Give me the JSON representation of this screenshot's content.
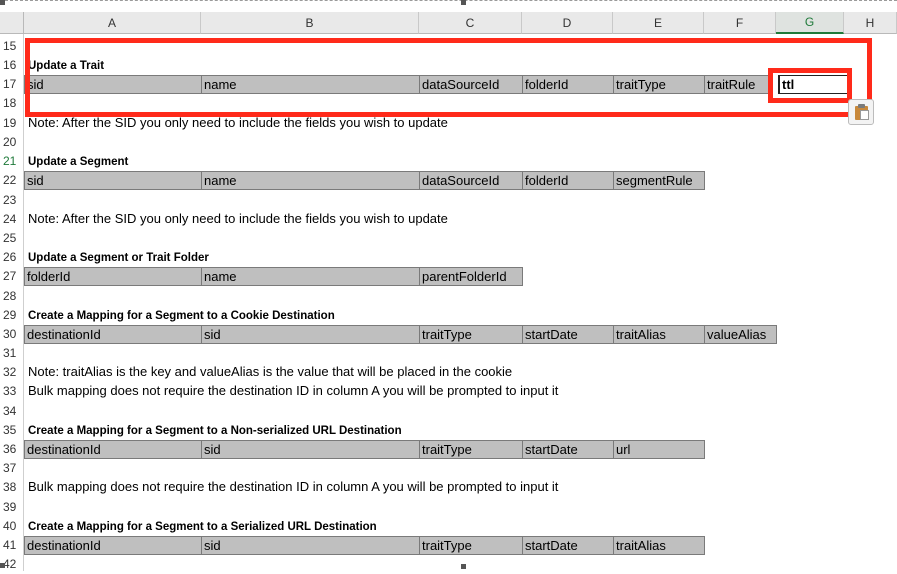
{
  "columns": [
    "A",
    "B",
    "C",
    "D",
    "E",
    "F",
    "G",
    "H"
  ],
  "rows": [
    "15",
    "16",
    "17",
    "18",
    "19",
    "20",
    "21",
    "22",
    "23",
    "24",
    "25",
    "26",
    "27",
    "28",
    "29",
    "30",
    "31",
    "32",
    "33",
    "34",
    "35",
    "36",
    "37",
    "38",
    "39",
    "40",
    "41",
    "42"
  ],
  "sections": {
    "update_trait": {
      "title": "Update a Trait",
      "fields": [
        "sid",
        "name",
        "dataSourceId",
        "folderId",
        "traitType",
        "traitRule"
      ],
      "selected_cell_value": "ttl",
      "note": "Note: After the SID you only need to include the fields you wish to update"
    },
    "update_segment": {
      "title": "Update a Segment",
      "fields": [
        "sid",
        "name",
        "dataSourceId",
        "folderId",
        "segmentRule"
      ],
      "note": "Note: After the SID you only need to include the fields you wish to update"
    },
    "update_folder": {
      "title": "Update a Segment or Trait Folder",
      "fields": [
        "folderId",
        "name",
        "parentFolderId"
      ]
    },
    "cookie_destination": {
      "title": "Create a Mapping for a Segment to a Cookie Destination",
      "fields": [
        "destinationId",
        "sid",
        "traitType",
        "startDate",
        "traitAlias",
        "valueAlias"
      ],
      "note1": "Note: traitAlias is the key and valueAlias is the value that will be placed in the cookie",
      "note2": "Bulk mapping does not require the destination ID in column A you will be prompted to input it"
    },
    "nonserialized_url": {
      "title": "Create a Mapping for a Segment to a Non-serialized URL Destination",
      "fields": [
        "destinationId",
        "sid",
        "traitType",
        "startDate",
        "url"
      ],
      "note": "Bulk mapping does not require the destination ID in column A you will be prompted to input it"
    },
    "serialized_url": {
      "title": "Create a Mapping for a Segment to a Serialized URL Destination",
      "fields": [
        "destinationId",
        "sid",
        "traitType",
        "startDate",
        "traitAlias"
      ]
    }
  },
  "colors": {
    "highlight": "#ff2a1a",
    "header_bg": "#e9e9e9",
    "cell_gray": "#bfbfbf",
    "selected_column": "#1f7a3a"
  }
}
